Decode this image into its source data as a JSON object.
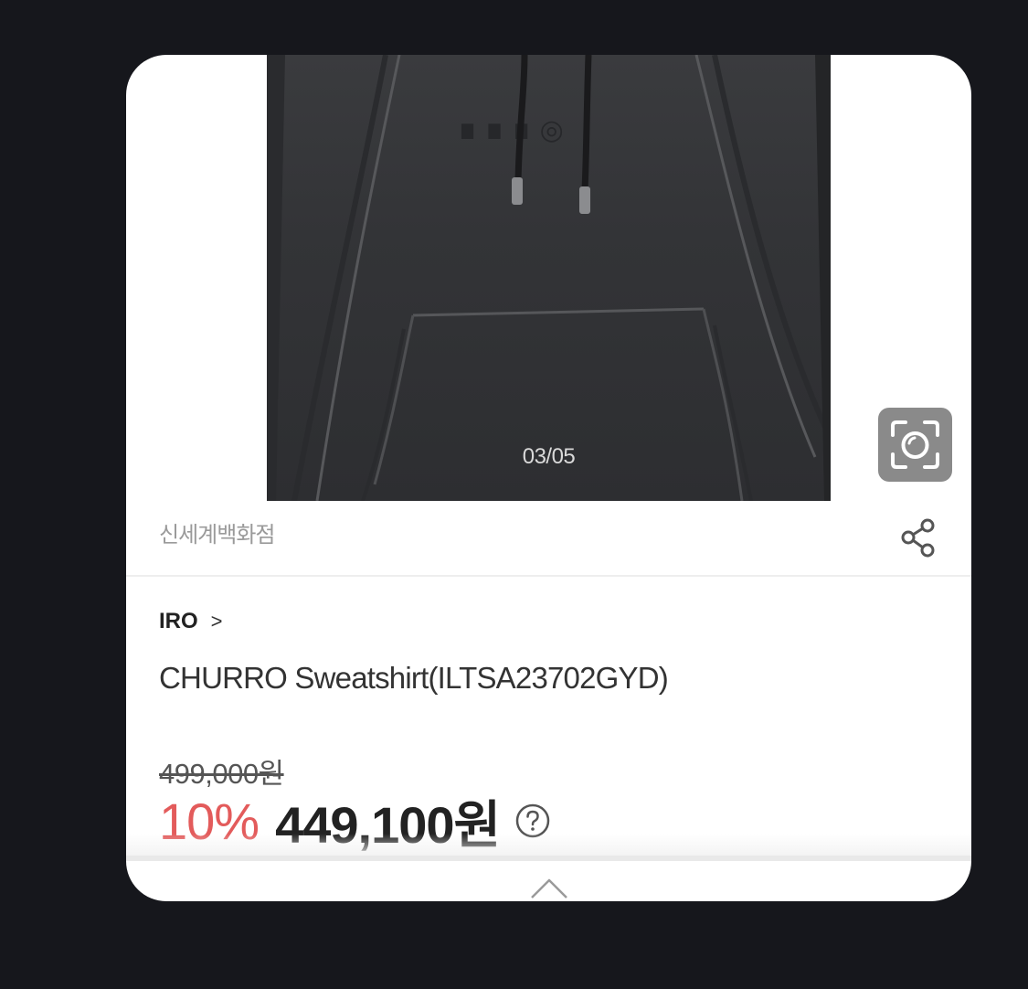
{
  "image": {
    "counter": "03/05"
  },
  "seller": {
    "name": "신세계백화점"
  },
  "product": {
    "brand": "IRO",
    "brand_chevron": ">",
    "name": "CHURRO Sweatshirt(ILTSA23702GYD)",
    "original_price": "499,000원",
    "discount": "10%",
    "sale_price": "449,100원"
  },
  "icons": {
    "scan": "camera-scan-icon",
    "share": "share-icon",
    "help": "question-circle-icon",
    "expand": "chevron-up-icon"
  },
  "colors": {
    "background": "#16171c",
    "card": "#ffffff",
    "discount": "#e35b5b",
    "price": "#222222",
    "seller": "#9a9a9a"
  }
}
